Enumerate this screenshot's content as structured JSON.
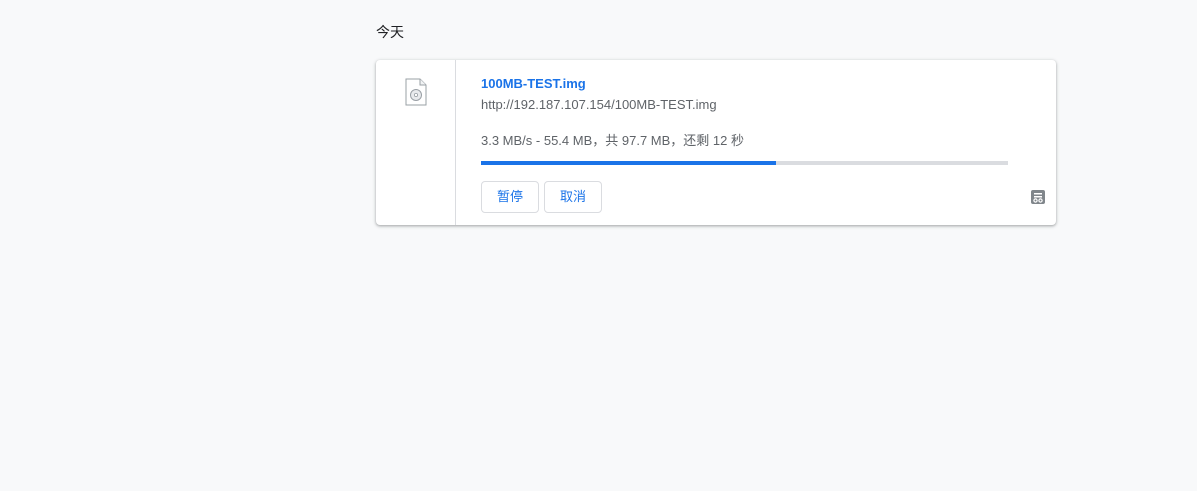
{
  "section": {
    "title": "今天"
  },
  "download": {
    "file_name": "100MB-TEST.img",
    "url": "http://192.187.107.154/100MB-TEST.img",
    "status": "3.3 MB/s - 55.4 MB，共 97.7 MB，还剩 12 秒",
    "progress_fraction": 0.56,
    "icon": "generic-file-icon",
    "side_icon": "download-archive-icon",
    "pause_label": "暂停",
    "cancel_label": "取消"
  },
  "colors": {
    "accent": "#1a73e8",
    "track": "#dadce0",
    "background": "#f8f9fa"
  }
}
